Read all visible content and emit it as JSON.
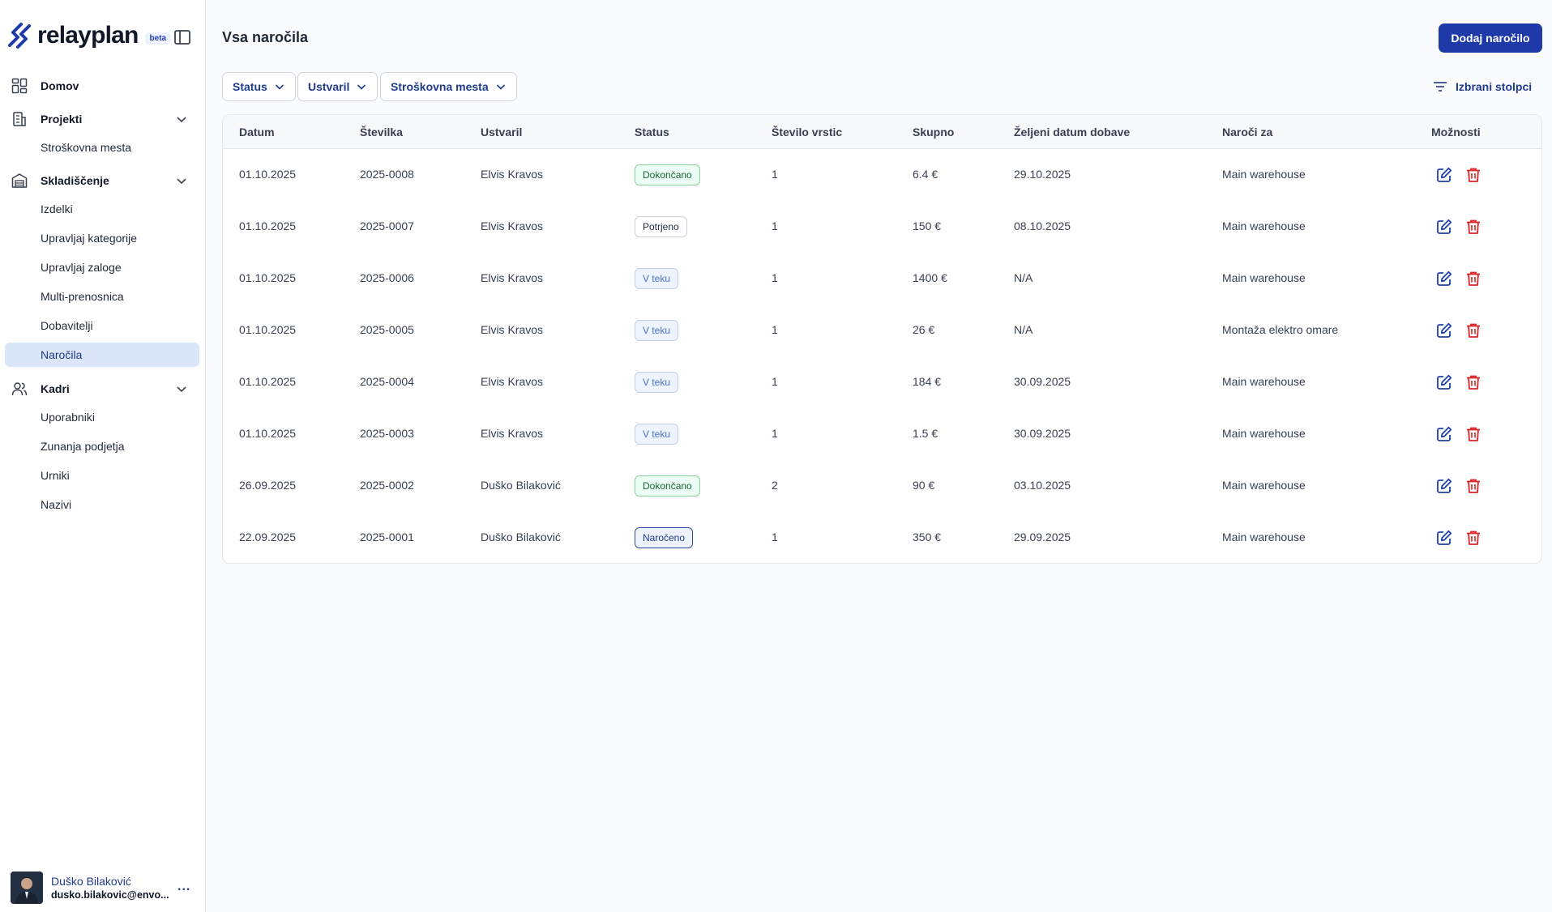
{
  "brand": {
    "name": "relayplan",
    "badge": "beta",
    "logo_icon": "relayplan-logo-icon"
  },
  "sidebar": {
    "toggle_icon": "sidebar-panel-icon",
    "sections": [
      {
        "label": "Domov",
        "icon": "dashboard-grid-icon",
        "expandable": false,
        "items": []
      },
      {
        "label": "Projekti",
        "icon": "building-icon",
        "expandable": true,
        "items": [
          {
            "label": "Stroškovna mesta"
          }
        ]
      },
      {
        "label": "Skladiščenje",
        "icon": "warehouse-icon",
        "expandable": true,
        "items": [
          {
            "label": "Izdelki"
          },
          {
            "label": "Upravljaj kategorije"
          },
          {
            "label": "Upravljaj zaloge"
          },
          {
            "label": "Multi-prenosnica"
          },
          {
            "label": "Dobavitelji"
          },
          {
            "label": "Naročila",
            "active": true
          }
        ]
      },
      {
        "label": "Kadri",
        "icon": "users-icon",
        "expandable": true,
        "items": [
          {
            "label": "Uporabniki"
          },
          {
            "label": "Zunanja podjetja"
          },
          {
            "label": "Urniki"
          },
          {
            "label": "Nazivi"
          }
        ]
      }
    ]
  },
  "user": {
    "name": "Duško Bilaković",
    "email": "dusko.bilakovic@envo...",
    "more": "..."
  },
  "main": {
    "title": "Vsa naročila",
    "add_button": "Dodaj naročilo",
    "filters": [
      {
        "label": "Status"
      },
      {
        "label": "Ustvaril"
      },
      {
        "label": "Stroškovna mesta"
      }
    ],
    "columns_button": "Izbrani stolpci"
  },
  "table": {
    "columns": [
      "Datum",
      "Številka",
      "Ustvaril",
      "Status",
      "Število vrstic",
      "Skupno",
      "Željeni datum dobave",
      "Naroči za",
      "Možnosti"
    ],
    "rows": [
      {
        "datum": "01.10.2025",
        "stevilka": "2025-0008",
        "ustvaril": "Elvis Kravos",
        "status": "Dokončano",
        "status_type": "green",
        "vrstic": "1",
        "skupno": "6.4 €",
        "dobava": "29.10.2025",
        "za": "Main warehouse"
      },
      {
        "datum": "01.10.2025",
        "stevilka": "2025-0007",
        "ustvaril": "Elvis Kravos",
        "status": "Potrjeno",
        "status_type": "gray",
        "vrstic": "1",
        "skupno": "150 €",
        "dobava": "08.10.2025",
        "za": "Main warehouse"
      },
      {
        "datum": "01.10.2025",
        "stevilka": "2025-0006",
        "ustvaril": "Elvis Kravos",
        "status": "V teku",
        "status_type": "blue",
        "vrstic": "1",
        "skupno": "1400 €",
        "dobava": "N/A",
        "za": "Main warehouse"
      },
      {
        "datum": "01.10.2025",
        "stevilka": "2025-0005",
        "ustvaril": "Elvis Kravos",
        "status": "V teku",
        "status_type": "blue",
        "vrstic": "1",
        "skupno": "26 €",
        "dobava": "N/A",
        "za": "Montaža elektro omare"
      },
      {
        "datum": "01.10.2025",
        "stevilka": "2025-0004",
        "ustvaril": "Elvis Kravos",
        "status": "V teku",
        "status_type": "blue",
        "vrstic": "1",
        "skupno": "184 €",
        "dobava": "30.09.2025",
        "za": "Main warehouse"
      },
      {
        "datum": "01.10.2025",
        "stevilka": "2025-0003",
        "ustvaril": "Elvis Kravos",
        "status": "V teku",
        "status_type": "blue",
        "vrstic": "1",
        "skupno": "1.5 €",
        "dobava": "30.09.2025",
        "za": "Main warehouse"
      },
      {
        "datum": "26.09.2025",
        "stevilka": "2025-0002",
        "ustvaril": "Duško Bilaković",
        "status": "Dokončano",
        "status_type": "green",
        "vrstic": "2",
        "skupno": "90 €",
        "dobava": "03.10.2025",
        "za": "Main warehouse"
      },
      {
        "datum": "22.09.2025",
        "stevilka": "2025-0001",
        "ustvaril": "Duško Bilaković",
        "status": "Naročeno",
        "status_type": "navy",
        "vrstic": "1",
        "skupno": "350 €",
        "dobava": "29.09.2025",
        "za": "Main warehouse"
      }
    ],
    "row_actions": {
      "edit_icon": "edit-icon",
      "delete_icon": "trash-icon"
    }
  },
  "colors": {
    "primary": "#1e3aa8",
    "active_nav_bg": "#dbe6f8",
    "delete": "#dc2626",
    "edit": "#1e40af"
  }
}
